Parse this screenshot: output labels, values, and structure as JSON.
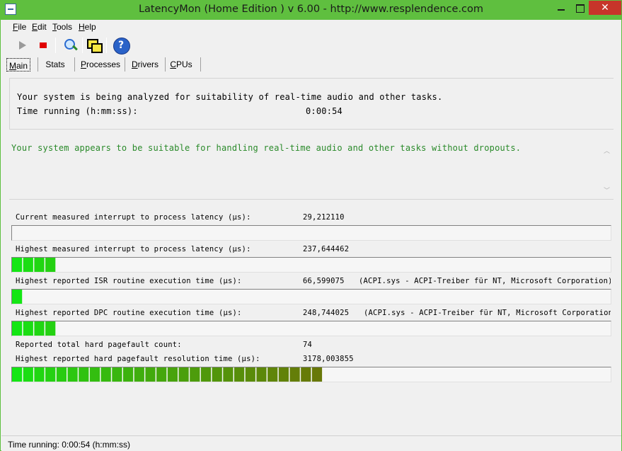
{
  "window": {
    "title": "LatencyMon  (Home Edition )  v 6.00 - http://www.resplendence.com",
    "close_glyph": "✕"
  },
  "menu": [
    {
      "label": "File",
      "accel": "F",
      "rest": "ile"
    },
    {
      "label": "Edit",
      "accel": "E",
      "rest": "dit"
    },
    {
      "label": "Tools",
      "accel": "T",
      "rest": "ools"
    },
    {
      "label": "Help",
      "accel": "H",
      "rest": "elp"
    }
  ],
  "toolbar": {
    "icons": [
      "play-icon",
      "stop-icon",
      "search-drivers-icon",
      "windows-icon",
      "help-icon"
    ],
    "help_glyph": "?"
  },
  "tabs": [
    {
      "label": "Main",
      "accel": "M",
      "rest": "ain",
      "active": true
    },
    {
      "label": "Stats",
      "accel": "",
      "rest": "Stats",
      "active": false
    },
    {
      "label": "Processes",
      "accel": "P",
      "rest": "rocesses",
      "active": false
    },
    {
      "label": "Drivers",
      "accel": "D",
      "rest": "rivers",
      "active": false
    },
    {
      "label": "CPUs",
      "accel": "C",
      "rest": "PUs",
      "active": false
    }
  ],
  "info": {
    "analyzing": "Your system is being analyzed for suitability of real-time audio and other tasks.",
    "time_label": "Time running (h:mm:ss):",
    "time_value": "0:00:54"
  },
  "verdict": {
    "text": "Your system appears to be suitable for handling real-time audio and other tasks without dropouts.",
    "color": "#2a8a2a"
  },
  "metrics": [
    {
      "label": "Current measured interrupt to process latency (µs):",
      "value": "29,212110",
      "extra": "",
      "level": 0.0
    },
    {
      "label": "Highest measured interrupt to process latency (µs):",
      "value": "237,644462",
      "extra": "",
      "level": 4
    },
    {
      "label": "Highest reported ISR routine execution time (µs):",
      "value": "66,599075",
      "extra": "(ACPI.sys - ACPI-Treiber für NT, Microsoft Corporation)",
      "level": 1
    },
    {
      "label": "Highest reported DPC routine execution time (µs):",
      "value": "248,744025",
      "extra": "(ACPI.sys - ACPI-Treiber für NT, Microsoft Corporation)",
      "level": 4
    },
    {
      "label": "Reported total hard pagefault count:",
      "value": "74",
      "extra": "",
      "level": null
    },
    {
      "label": "Highest reported hard pagefault resolution time (µs):",
      "value": "3178,003855",
      "extra": "",
      "level": 28
    }
  ],
  "bar_colors": {
    "start": "#14e614",
    "end": "#a03000",
    "total_segments": 54
  },
  "status": {
    "text": "Time running: 0:00:54  (h:mm:ss)"
  }
}
